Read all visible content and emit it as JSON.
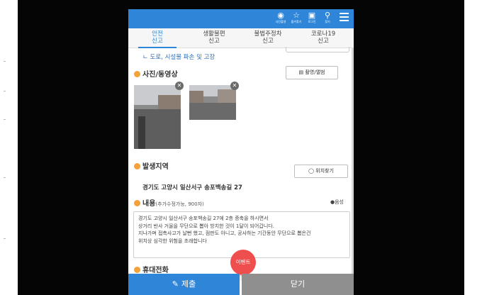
{
  "topbar": {
    "buttons": [
      {
        "icon": "camera-icon",
        "label": "사진촬영"
      },
      {
        "icon": "star-icon",
        "label": "즐겨찾기"
      },
      {
        "icon": "lock-icon",
        "label": "로그인"
      },
      {
        "icon": "search-icon",
        "label": "찾기"
      }
    ],
    "menu_icon": "hamburger-menu-icon"
  },
  "tabs": [
    {
      "line1": "안전",
      "line2": "신고",
      "active": true
    },
    {
      "line1": "생활불편",
      "line2": "신고",
      "active": false
    },
    {
      "line1": "불법주정차",
      "line2": "신고",
      "active": false
    },
    {
      "line1": "코로나19",
      "line2": "신고",
      "active": false
    }
  ],
  "form": {
    "category_line": "ㄴ 도로, 시설물 파손 및 고장",
    "media": {
      "title": "사진/동영상",
      "button": "촬영/앨범",
      "remove_icon": "close-icon"
    },
    "location": {
      "title": "발생지역",
      "button": "위치찾기",
      "address": "경기도 고양시 일산서구 송포백송길 27"
    },
    "content": {
      "title": "내용",
      "subtitle": "(추가수정가능, 900자)",
      "voice": "음성",
      "text_lines": [
        "경기도 고양시 일산서구 송포백송길 27에 2층 증축을 하시면서",
        "상거리 반사 거울을 무단으로 뽑아 방치한 것이 1달이 되어갑니다.",
        "지나가며 접촉사고가 날뻔 했고, 점판도 아니고, 공사하는 기간동안 무단으로 뽑은건",
        "위치상 심각한 위험을 초래합니다"
      ]
    },
    "phone": {
      "title": "휴대전화"
    },
    "event_badge": "이벤트"
  },
  "bottom": {
    "submit": "제출",
    "close": "닫기"
  },
  "colors": {
    "accent": "#2f86d8",
    "section_dot": "#f5a13a",
    "event": "#ef4e4e",
    "close_button": "#8f8f8f"
  }
}
